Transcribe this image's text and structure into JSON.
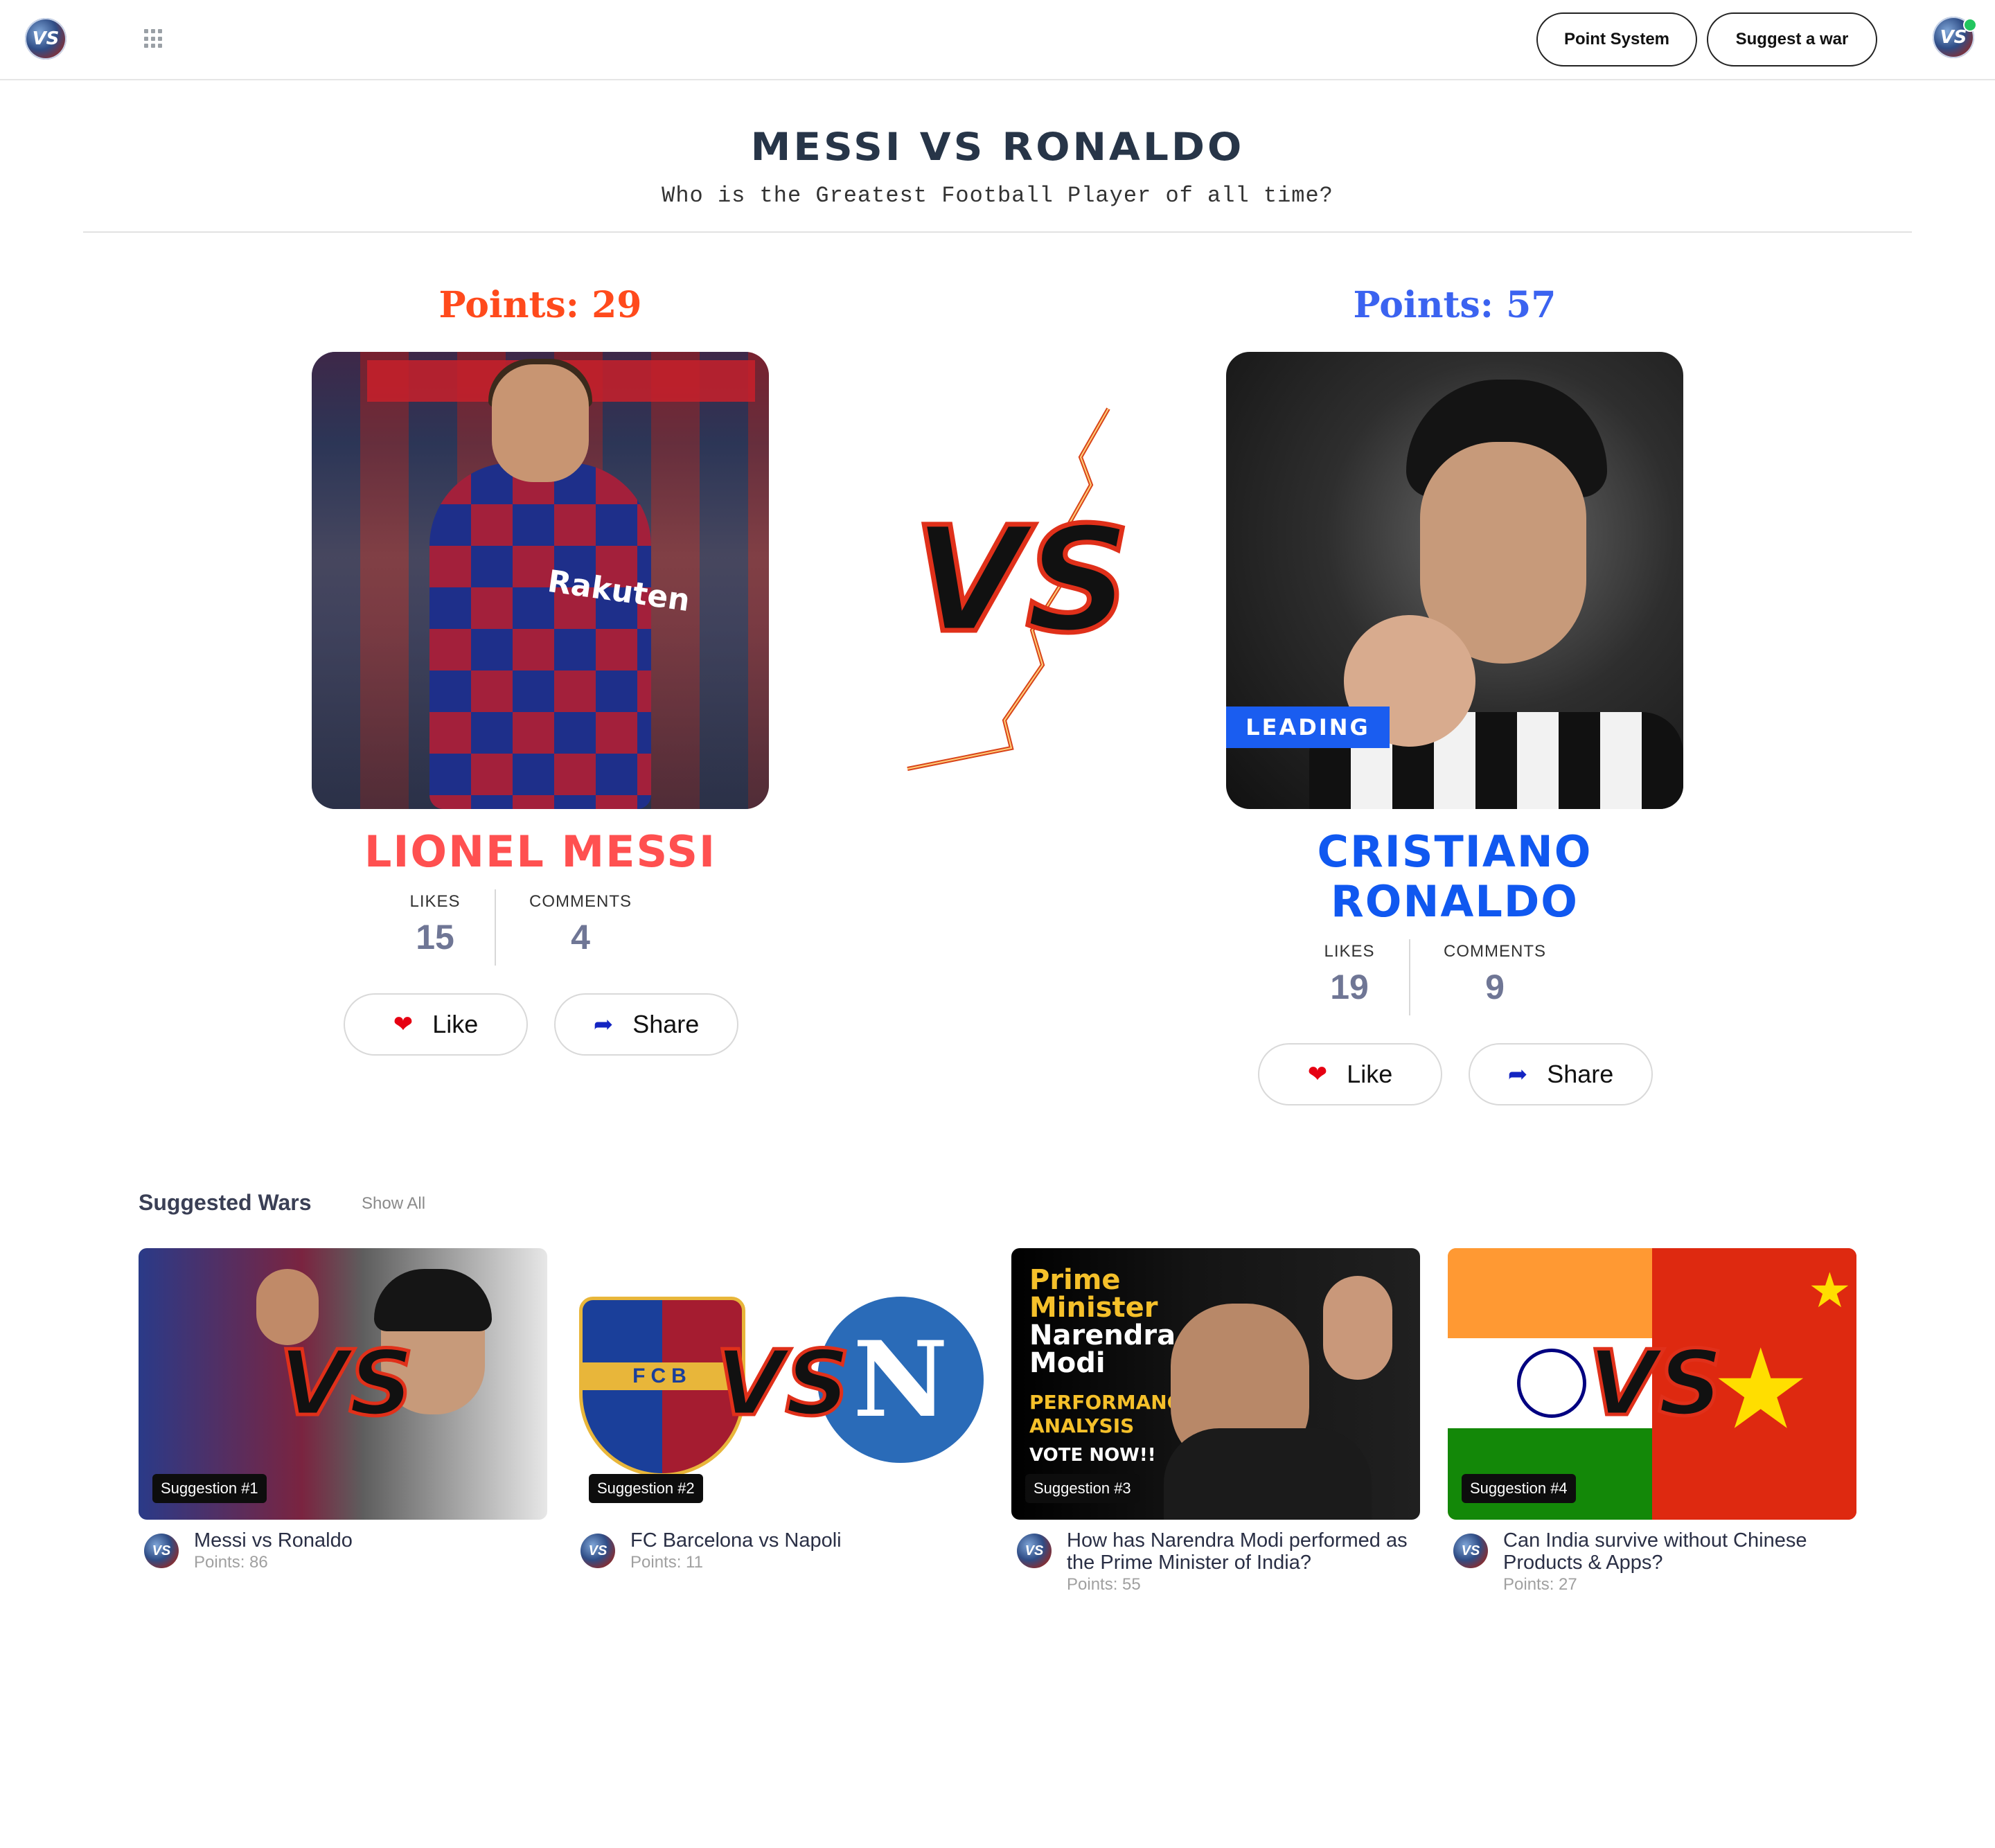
{
  "nav": {
    "logo_text": "VS",
    "apps_icon": "grid-icon",
    "point_system_label": "Point System",
    "suggest_war_label": "Suggest a war",
    "profile_avatar_text": "VS"
  },
  "war": {
    "title": "MESSI VS RONALDO",
    "subtitle": "Who is the Greatest Football Player of all time?"
  },
  "left": {
    "points_text": "Points: 29",
    "points": 29,
    "name": "LIONEL MESSI",
    "likes_label": "LIKES",
    "likes": "15",
    "comments_label": "COMMENTS",
    "comments": "4",
    "like_label": "Like",
    "share_label": "Share",
    "points_color": "#ff4a1c",
    "name_color": "#ff5050",
    "photo_text": "Rakuten"
  },
  "right": {
    "points_text": "Points: 57",
    "points": 57,
    "name_line1": "CRISTIANO",
    "name_line2": "RONALDO",
    "badge": "LEADING",
    "likes_label": "LIKES",
    "likes": "19",
    "comments_label": "COMMENTS",
    "comments": "9",
    "like_label": "Like",
    "share_label": "Share",
    "points_color": "#3b63f0",
    "name_color": "#1058f0"
  },
  "vs_text": "VS",
  "suggested": {
    "title": "Suggested Wars",
    "show_all": "Show All",
    "items": [
      {
        "badge": "Suggestion #1",
        "title": "Messi vs Ronaldo",
        "points": "Points: 86"
      },
      {
        "badge": "Suggestion #2",
        "title": "FC Barcelona vs Napoli",
        "points": "Points: 11",
        "logo_left": "FCB",
        "logo_right": "N"
      },
      {
        "badge": "Suggestion #3",
        "title": "How has Narendra Modi performed as the Prime Minister of India?",
        "points": "Points: 55",
        "thumb_line1": "Prime",
        "thumb_line2": "Minister",
        "thumb_line3": "Narendra",
        "thumb_line4": "Modi",
        "thumb_line5": "PERFORMANCE",
        "thumb_line6": "ANALYSIS",
        "thumb_line7": "VOTE NOW!!"
      },
      {
        "badge": "Suggestion #4",
        "title": "Can India survive without Chinese Products & Apps?",
        "points": "Points: 27"
      }
    ]
  }
}
